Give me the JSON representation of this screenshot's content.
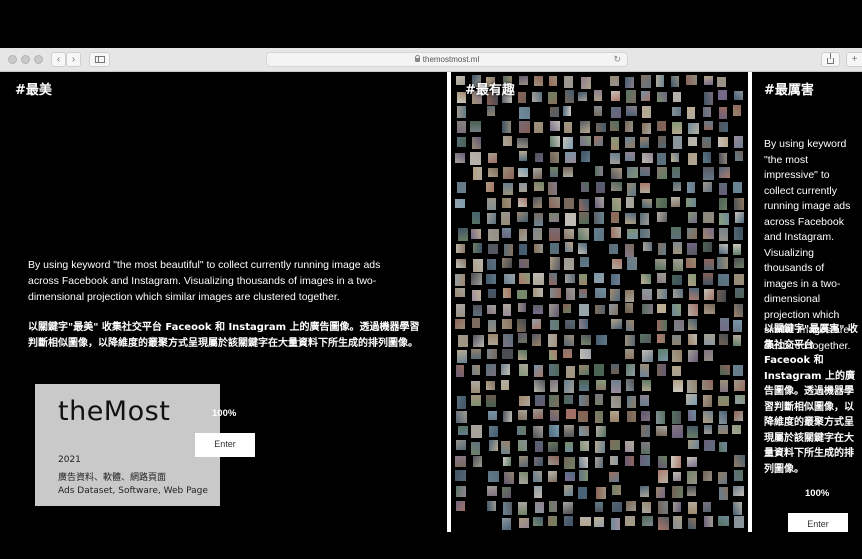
{
  "browser": {
    "url": "themostmost.ml",
    "back_glyph": "‹",
    "forward_glyph": "›",
    "reload_glyph": "↻"
  },
  "panels": {
    "left": {
      "tag": "#最美",
      "description_en": "By using keyword \"the most beautiful\" to collect currently running image ads across Facebook and Instagram. Visualizing thousands of images in a two-dimensional projection which similar images are clustered together.",
      "description_zh": "以關鍵字\"最美\" 收集社交平台 Faceook 和 Instagram 上的廣告圖像。透過機器學習判斷相似圖像，以降維度的叢聚方式呈現屬於該關鍵字在大量資料下所生成的排列圖像。",
      "progress": "100%",
      "progress_value": 100,
      "enter_label": "Enter"
    },
    "middle": {
      "tag": "#最有趣"
    },
    "right": {
      "tag": "#最厲害",
      "description_en": "By using keyword \"the most impressive\" to collect currently running image ads across Facebook and Instagram. Visualizing thousands of images in a two-dimensional projection which similar images are clustered together.",
      "description_zh": "以關鍵字\"最厲害\" 收集社交平台 Faceook 和 Instagram 上的廣告圖像。透過機器學習判斷相似圖像，以降維度的叢聚方式呈現屬於該關鍵字在大量資料下所生成的排列圖像。",
      "progress": "100%",
      "progress_value": 100,
      "enter_label": "Enter"
    }
  },
  "card": {
    "title": "theMost",
    "year": "2021",
    "categories_zh": "廣告資料、軟體、網路頁面",
    "categories_en": "Ads Dataset, Software, Web Page"
  },
  "colors": {
    "background": "#000000",
    "card": "#c9c9c9",
    "chrome": "#e6e6e6",
    "text": "#ffffff"
  }
}
